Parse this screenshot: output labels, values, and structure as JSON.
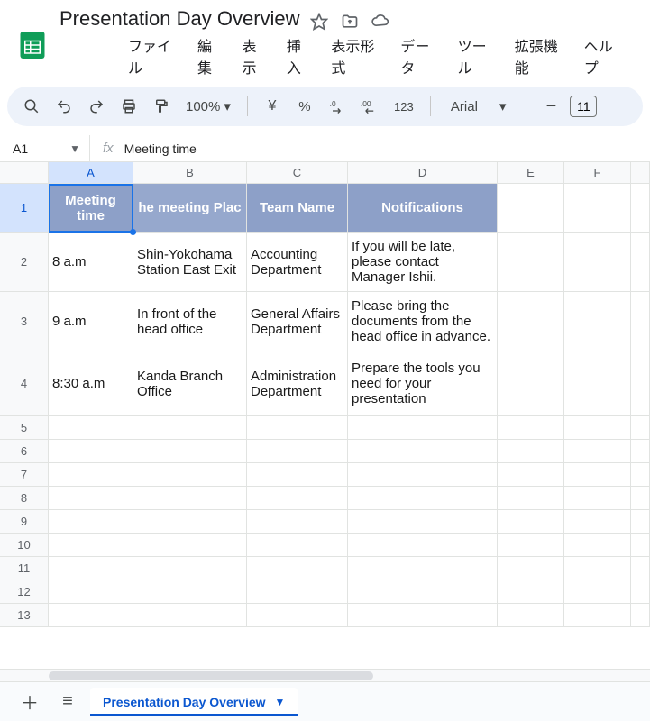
{
  "doc": {
    "title": "Presentation Day Overview"
  },
  "menu": {
    "file": "ファイル",
    "edit": "編集",
    "view": "表示",
    "insert": "挿入",
    "format": "表示形式",
    "data": "データ",
    "tools": "ツール",
    "extensions": "拡張機能",
    "help": "ヘルプ"
  },
  "toolbar": {
    "zoom": "100%",
    "currency": "¥",
    "percent": "%",
    "num123": "123",
    "font": "Arial",
    "font_size": "11"
  },
  "namebox": {
    "ref": "A1"
  },
  "formula": {
    "fx": "fx",
    "value": "Meeting time"
  },
  "columns": [
    "A",
    "B",
    "C",
    "D",
    "E",
    "F"
  ],
  "headers": {
    "a": "Meeting time",
    "b": "he meeting Plac",
    "c": "Team Name",
    "d": "Notifications"
  },
  "rows": [
    {
      "n": 2,
      "a": "8 a.m",
      "b": "Shin-Yokohama Station East Exit",
      "c": "Accounting Department",
      "d": "If you will be late, please contact Manager Ishii."
    },
    {
      "n": 3,
      "a": "9 a.m",
      "b": "In front of the head office",
      "c": "General Affairs Department",
      "d": "Please bring the documents from the head office in advance."
    },
    {
      "n": 4,
      "a": "8:30 a.m",
      "b": "Kanda Branch Office",
      "c": "Administration Department",
      "d": "Prepare the tools you need for your presentation"
    }
  ],
  "empty_rows": [
    5,
    6,
    7,
    8,
    9,
    10,
    11,
    12,
    13
  ],
  "sheet": {
    "name": "Presentation Day Overview"
  }
}
